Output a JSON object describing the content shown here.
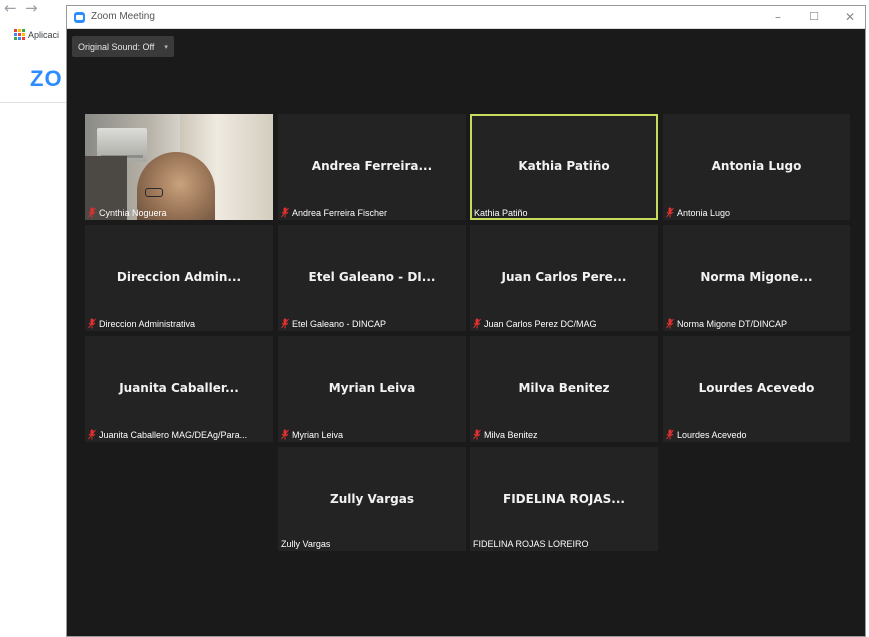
{
  "browser": {
    "apps_label": "Aplicaci",
    "brand_text": "ZO"
  },
  "window": {
    "title": "Zoom Meeting",
    "minimize": "–",
    "maximize": "☐",
    "close": "✕"
  },
  "toolbar": {
    "sound_label": "Original Sound: Off",
    "sound_caret": "▾"
  },
  "participants": [
    {
      "display_name": "",
      "label": "Cynthia Noguera",
      "muted": true,
      "video": true
    },
    {
      "display_name": "Andrea Ferreira...",
      "label": "Andrea Ferreira Fischer",
      "muted": true
    },
    {
      "display_name": "Kathia Patiño",
      "label": "Kathia Patiño",
      "muted": false,
      "active": true
    },
    {
      "display_name": "Antonia Lugo",
      "label": "Antonia Lugo",
      "muted": true
    },
    {
      "display_name": "Direccion Admin...",
      "label": "Direccion Administrativa",
      "muted": true
    },
    {
      "display_name": "Etel Galeano - DI...",
      "label": "Etel Galeano - DINCAP",
      "muted": true
    },
    {
      "display_name": "Juan Carlos Pere...",
      "label": "Juan Carlos Perez DC/MAG",
      "muted": true
    },
    {
      "display_name": "Norma Migone...",
      "label": "Norma Migone DT/DINCAP",
      "muted": true
    },
    {
      "display_name": "Juanita Caballer...",
      "label": "Juanita Caballero MAG/DEAg/Para...",
      "muted": true
    },
    {
      "display_name": "Myrian Leiva",
      "label": "Myrian Leiva",
      "muted": true
    },
    {
      "display_name": "Milva Benitez",
      "label": "Milva Benitez",
      "muted": true
    },
    {
      "display_name": "Lourdes Acevedo",
      "label": "Lourdes Acevedo",
      "muted": true
    },
    {
      "display_name": "Zully Vargas",
      "label": "Zully Vargas",
      "muted": false
    },
    {
      "display_name": "FIDELINA ROJAS...",
      "label": "FIDELINA ROJAS LOREIRO",
      "muted": false
    }
  ],
  "colors": {
    "active_speaker_border": "#c6dc5a",
    "muted_icon": "#e03030",
    "tile_background": "#232323",
    "window_background": "#1a1a1a",
    "brand": "#2D8CFF"
  }
}
